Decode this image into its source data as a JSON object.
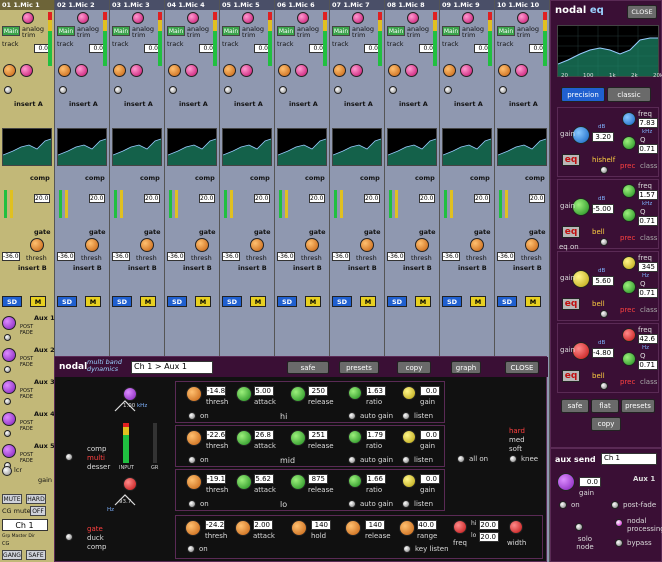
{
  "strips": [
    {
      "num": "01",
      "name": "1.Mic 1",
      "insert": "insert A",
      "insert_b": "insert B",
      "aux": "Aux 1",
      "sel": true
    },
    {
      "num": "02",
      "name": "1.Mic 2",
      "insert": "insert A",
      "insert_b": "insert B"
    },
    {
      "num": "03",
      "name": "1.Mic 3",
      "insert": "insert A",
      "insert_b": "insert B"
    },
    {
      "num": "04",
      "name": "1.Mic 4",
      "insert": "insert A",
      "insert_b": "insert B"
    },
    {
      "num": "05",
      "name": "1.Mic 5",
      "insert": "insert A",
      "insert_b": "insert B"
    },
    {
      "num": "06",
      "name": "1.Mic 6",
      "insert": "insert A",
      "insert_b": "insert B"
    },
    {
      "num": "07",
      "name": "1.Mic 7",
      "insert": "insert A",
      "insert_b": "insert B"
    },
    {
      "num": "08",
      "name": "1.Mic 8",
      "insert": "insert A",
      "insert_b": "insert B"
    },
    {
      "num": "09",
      "name": "1.Mic 9",
      "insert": "insert A",
      "insert_b": "insert B"
    },
    {
      "num": "10",
      "name": "1.Mic 10",
      "insert": "insert A",
      "insert_b": "insert B"
    }
  ],
  "strip_common": {
    "main": "Main",
    "analog_trim": "analog trim",
    "track": "track",
    "gain_val": "0.0",
    "comp": "comp",
    "gate": "gate",
    "sd": "SD",
    "m": "M",
    "thresh": "thresh",
    "thresh_val": "-36.0",
    "comp_val": "20.0",
    "gate_val": "20.0"
  },
  "left_aux": [
    {
      "label": "Aux 1",
      "post": "POST FADE"
    },
    {
      "label": "Aux 2",
      "post": "POST FADE"
    },
    {
      "label": "Aux 3",
      "post": "POST FADE"
    },
    {
      "label": "Aux 4",
      "post": "POST FADE"
    },
    {
      "label": "Aux 5",
      "post": "POST FADE"
    }
  ],
  "left_bottom": {
    "lcr": "lcr",
    "gain": "gain",
    "mute": "MUTE",
    "hard": "HARD",
    "cg_mute": "CG mute",
    "off": "OFF",
    "channel": "Ch 1",
    "grp": "Grp Master Dir",
    "cg": "CG",
    "gang": "GANG",
    "safe": "SAFE"
  },
  "eq_panel": {
    "title_a": "nodal",
    "title_b": "eq",
    "close": "CLOSE",
    "x_ticks": [
      "20",
      "100",
      "1k",
      "2k",
      "20k"
    ],
    "precision": "precision",
    "classic": "classic",
    "bands": [
      {
        "gain": "3.20",
        "freq": "7.83",
        "q": "0.71",
        "type": "hishelf",
        "prec": "prec",
        "class": "class",
        "freq_unit": "kHz"
      },
      {
        "gain": "-5.00",
        "freq": "1.57",
        "q": "0.71",
        "type": "bell",
        "prec": "prec",
        "class": "class",
        "freq_unit": "kHz"
      },
      {
        "gain": "5.60",
        "freq": "345",
        "q": "0.71",
        "type": "bell",
        "prec": "prec",
        "class": "class",
        "freq_unit": "Hz"
      },
      {
        "gain": "-4.80",
        "freq": "42.6",
        "q": "0.71",
        "type": "bell",
        "prec": "prec",
        "class": "class",
        "freq_unit": "Hz"
      }
    ],
    "gain_label": "gain",
    "freq_label": "freq",
    "q_label": "Q",
    "eq_btn": "eq",
    "eq_on": "eq on",
    "db_unit": "dB",
    "safe": "safe",
    "flat": "flat",
    "presets": "presets",
    "copy": "copy"
  },
  "aux_send": {
    "title": "aux send",
    "channel": "Ch 1",
    "aux": "Aux 1",
    "gain_val": "0.0",
    "gain": "gain",
    "on": "on",
    "post_fade": "post-fade",
    "solo_node": "solo node",
    "nodal_processing": "nodal processing",
    "bypass": "bypass"
  },
  "dyn_panel": {
    "title_a": "nodal",
    "title_b": "multi band dynamics",
    "channel": "Ch 1 > Aux 1",
    "safe": "safe",
    "presets": "presets",
    "copy": "copy",
    "graph": "graph",
    "close": "CLOSE",
    "comp_label": "comp",
    "multi_label": "multi",
    "desser_label": "desser",
    "gate_label": "gate",
    "duck_label": "duck",
    "comp2_label": "comp",
    "meter_val": "1.00",
    "meter_unit": "kHz",
    "input_label": "INPUT",
    "gr_label": "GR",
    "freq_low": "93.7",
    "freq_unit": "Hz",
    "bands": [
      {
        "name": "hi",
        "thresh": "-14.8",
        "attack": "5.00",
        "release": "250",
        "ratio": "1.63",
        "gain": "0.0",
        "on": "on",
        "auto_gain": "auto gain",
        "listen": "listen"
      },
      {
        "name": "mid",
        "thresh": "-22.6",
        "attack": "26.8",
        "release": "251",
        "ratio": "1.79",
        "gain": "0.0",
        "on": "on",
        "auto_gain": "auto gain",
        "listen": "listen"
      },
      {
        "name": "lo",
        "thresh": "-19.1",
        "attack": "5.62",
        "release": "875",
        "ratio": "1.66",
        "gain": "0.0",
        "on": "on",
        "auto_gain": "auto gain",
        "listen": "listen"
      }
    ],
    "labels": {
      "thresh": "thresh",
      "attack": "attack",
      "release": "release",
      "ratio": "ratio",
      "gain": "gain",
      "hold": "hold",
      "range": "range",
      "key_listen": "key listen",
      "all_on": "all on",
      "knee": "knee",
      "hard": "hard",
      "med": "med",
      "soft": "soft",
      "freq": "freq",
      "width": "width",
      "db": "dB",
      "ms": "ms",
      "on": "on"
    },
    "gate_row": {
      "thresh": "-24.2",
      "attack": "2.00",
      "hold": "140",
      "release": "140",
      "range": "40.0",
      "freq_hi": "20.0",
      "freq_lo": "20.0",
      "hi_label": "hi",
      "lo_label": "lo"
    }
  }
}
